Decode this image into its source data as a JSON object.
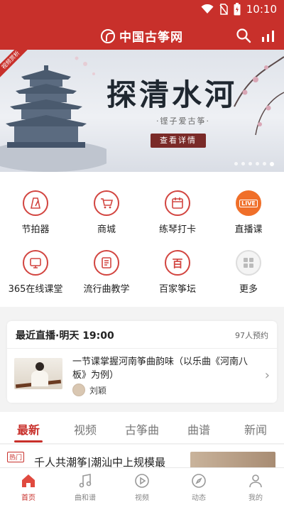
{
  "statusbar": {
    "time": "10:10",
    "icons": [
      "wifi-icon",
      "no-sim-icon",
      "battery-icon"
    ]
  },
  "header": {
    "brand": "中国古筝网",
    "icons": [
      "search-icon",
      "stats-icon"
    ],
    "brand_color": "#c8302b"
  },
  "banner": {
    "tag": "视频赏析",
    "title": "探清水河",
    "subtitle": "·铿子爱古筝·",
    "cta": "查看详情",
    "dot_count": 6,
    "active_dot": 0
  },
  "features": [
    {
      "label": "节拍器",
      "icon": "metronome-icon"
    },
    {
      "label": "商城",
      "icon": "cart-icon"
    },
    {
      "label": "练琴打卡",
      "icon": "calendar-icon"
    },
    {
      "label": "直播课",
      "icon": "live-icon",
      "icon_text": "LIVE"
    },
    {
      "label": "365在线课堂",
      "icon": "classroom-icon"
    },
    {
      "label": "流行曲教学",
      "icon": "sheet-music-icon"
    },
    {
      "label": "百家筝坛",
      "icon": "forum-icon",
      "icon_text": "百"
    },
    {
      "label": "更多",
      "icon": "more-grid-icon"
    }
  ],
  "live": {
    "heading": "最近直播·明天 19:00",
    "count": "97人预约",
    "lesson_title": "一节课掌握河南筝曲韵味（以乐曲《河南八板》为例）",
    "teacher": "刘颖"
  },
  "tabs": [
    {
      "label": "最新",
      "active": true
    },
    {
      "label": "视频",
      "active": false
    },
    {
      "label": "古筝曲",
      "active": false
    },
    {
      "label": "曲谱",
      "active": false
    },
    {
      "label": "新闻",
      "active": false
    }
  ],
  "feed_peek": {
    "badge": "热门",
    "text": "千人共潮筝|潮汕中上规模最"
  },
  "bottom_nav": [
    {
      "label": "首页",
      "icon": "home-icon",
      "active": true
    },
    {
      "label": "曲和谱",
      "icon": "music-score-icon",
      "active": false
    },
    {
      "label": "视频",
      "icon": "video-play-icon",
      "active": false
    },
    {
      "label": "动态",
      "icon": "compass-icon",
      "active": false
    },
    {
      "label": "我的",
      "icon": "profile-icon",
      "active": false
    }
  ]
}
